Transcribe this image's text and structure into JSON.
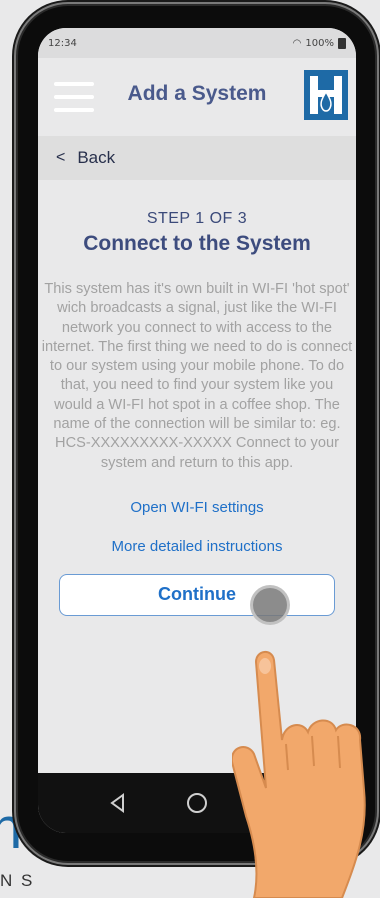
{
  "background_brand": {
    "partial_letter": "h",
    "partial_text": "N S"
  },
  "status_bar": {
    "time": "12:34",
    "battery": "100%"
  },
  "app_bar": {
    "title": "Add a System",
    "menu_icon": "hamburger-icon",
    "logo_icon": "company-logo-icon"
  },
  "nav": {
    "back_label": "Back"
  },
  "step": {
    "label": "STEP 1 OF 3",
    "title": "Connect to the System",
    "body": "This system has it's own built in WI-FI 'hot spot' wich broadcasts a signal, just like the WI-FI network you connect to with access to the internet. The first thing we need to do is connect to our system using your mobile phone. To do that, you need to find your system like you would a WI-FI hot spot in a coffee shop. The name of the connection will be similar to: eg. HCS-XXXXXXXXX-XXXXX Connect to your system and return to this app."
  },
  "actions": {
    "open_wifi": "Open WI-FI settings",
    "instructions": "More detailed instructions",
    "continue": "Continue"
  },
  "colors": {
    "brand_blue": "#1e6aa6",
    "title_navy": "#3d4c7e",
    "link_blue": "#1f70c8"
  }
}
